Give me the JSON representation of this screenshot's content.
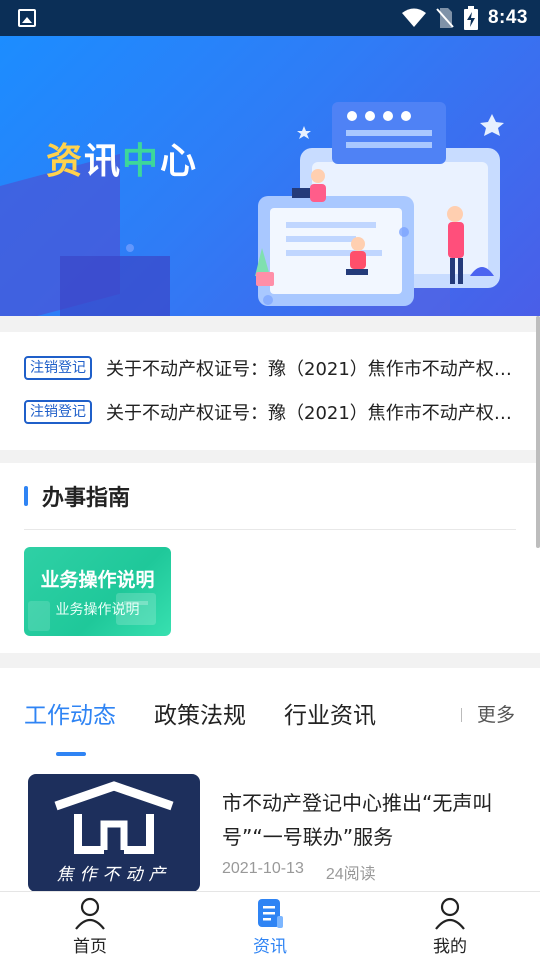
{
  "status_bar": {
    "time": "8:43"
  },
  "banner": {
    "title_chars": [
      "资",
      "讯",
      "中",
      "心"
    ]
  },
  "notices": [
    {
      "tag": "注销登记",
      "text": "关于不动产权证号：豫（2021）焦作市不动产权第..."
    },
    {
      "tag": "注销登记",
      "text": "关于不动产权证号：豫（2021）焦作市不动产权第..."
    }
  ],
  "guide": {
    "title": "办事指南",
    "card": {
      "title": "业务操作说明",
      "subtitle": "业务操作说明"
    }
  },
  "news": {
    "tabs": [
      {
        "label": "工作动态",
        "active": true
      },
      {
        "label": "政策法规",
        "active": false
      },
      {
        "label": "行业资讯",
        "active": false
      }
    ],
    "more_label": "更多",
    "items": [
      {
        "thumb_caption": "焦作不动产",
        "title": "市不动产登记中心推出“无声叫号”“一号联办”服务",
        "date": "2021-10-13",
        "reads": "24阅读"
      }
    ]
  },
  "bottom_nav": [
    {
      "label": "首页",
      "icon": "person-icon",
      "active": false
    },
    {
      "label": "资讯",
      "icon": "document-icon",
      "active": true
    },
    {
      "label": "我的",
      "icon": "user-icon",
      "active": false
    }
  ],
  "colors": {
    "accent": "#2f84f4",
    "tag_border": "#1f5fc9",
    "status_bar": "#0b2f57",
    "card_green": "#1fc89a"
  }
}
